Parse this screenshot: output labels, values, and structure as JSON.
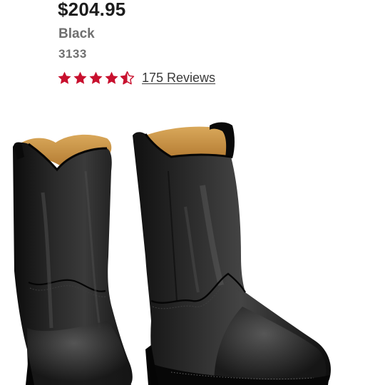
{
  "product": {
    "price": "$204.95",
    "color": "Black",
    "sku": "3133",
    "rating": {
      "value": 4.5,
      "max": 5,
      "star_color": "#c8102e",
      "reviews_label": "175 Reviews"
    },
    "image": {
      "subject": "pair-of-black-roper-boots-icon"
    }
  }
}
